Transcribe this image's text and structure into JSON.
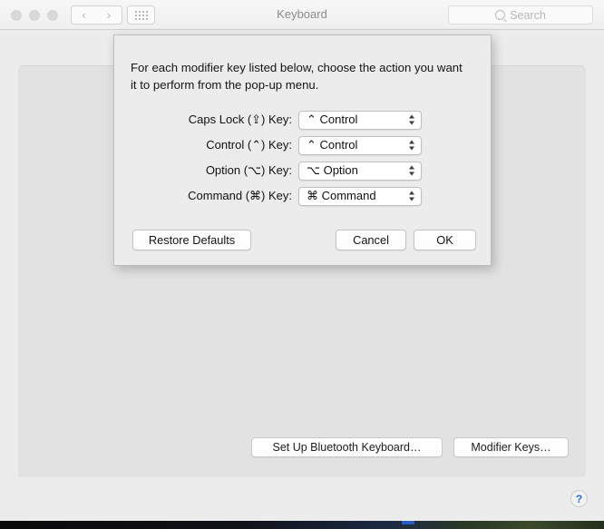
{
  "window": {
    "title": "Keyboard",
    "traffic_lights": [
      "close",
      "minimize",
      "zoom"
    ],
    "nav_back_icon": "‹",
    "nav_forward_icon": "›",
    "grid_icon": "grid-icon"
  },
  "search": {
    "placeholder": "Search",
    "icon": "search-icon"
  },
  "pane": {
    "bluetooth_button": "Set Up Bluetooth Keyboard…",
    "modifier_button": "Modifier Keys…",
    "help_label": "?"
  },
  "dialog": {
    "instructions": "For each modifier key listed below, choose the action you want it to perform from the pop-up menu.",
    "rows": [
      {
        "label": "Caps Lock (⇪) Key:",
        "value": "⌃ Control"
      },
      {
        "label": "Control (⌃) Key:",
        "value": "⌃ Control"
      },
      {
        "label": "Option (⌥) Key:",
        "value": "⌥ Option"
      },
      {
        "label": "Command (⌘) Key:",
        "value": "⌘ Command"
      }
    ],
    "restore_label": "Restore Defaults",
    "cancel_label": "Cancel",
    "ok_label": "OK"
  },
  "colors": {
    "window_bg": "#ececec",
    "panel_bg": "#e2e2e2",
    "toolbar_bg": "#f2f2f2",
    "help_blue": "#2a6ddb",
    "title_gray": "#8b8b8b"
  }
}
